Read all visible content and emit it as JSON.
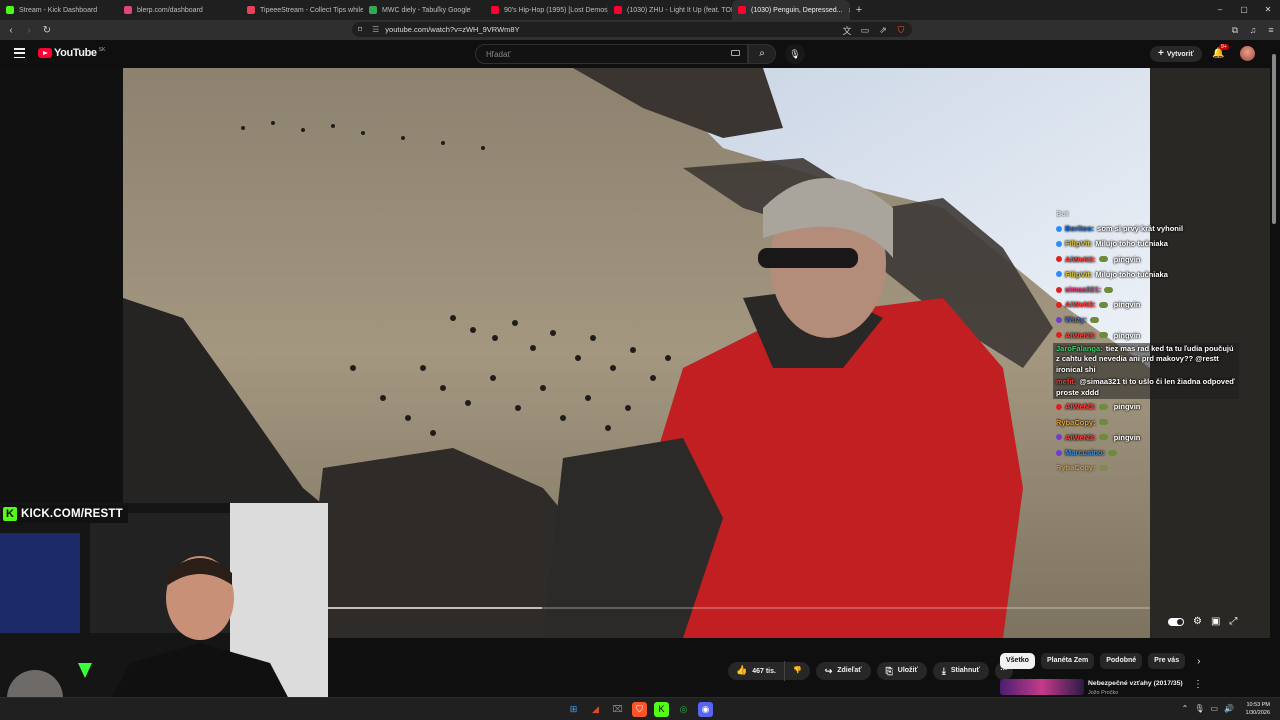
{
  "browser": {
    "tabs": [
      {
        "label": "Stream - Kick Dashboard",
        "color": "#53fc18"
      },
      {
        "label": "blerp.com/dashboard",
        "color": "#e0457b"
      },
      {
        "label": "TipeeeStream - Collect Tips while yo",
        "color": "#e8425b"
      },
      {
        "label": "MWC diely - Tabuľky Google",
        "color": "#34a853"
      },
      {
        "label": "90's Hip-Hop (1995) [Lost Demos] 8",
        "color": "#ff0033"
      },
      {
        "label": "(1030) ZHU - Light It Up (feat. TOKiY",
        "color": "#ff0033"
      },
      {
        "label": "(1030) Penguin, Depressed...",
        "color": "#ff0033",
        "active": true
      }
    ],
    "new_tab": "+",
    "window_controls": [
      "–",
      "▢",
      "✕"
    ],
    "url": "youtube.com/watch?v=zWH_9VRWm8Y"
  },
  "youtube": {
    "logo_text": "YouTube",
    "country_code": "SK",
    "search_placeholder": "Hľadať",
    "create_label": "Vytvoriť",
    "notification_count": "9+"
  },
  "video": {
    "progress_fraction": 0.26
  },
  "chat": [
    {
      "user": "Bot",
      "color": "#cfcfcf",
      "badge": "",
      "msg": "",
      "faded": true
    },
    {
      "user": "Boritoo:",
      "color": "#1e6fd9",
      "badge": "#2a8cff",
      "msg": "som si prvý krát vyhonil"
    },
    {
      "user": "FilipVit:",
      "color": "#d4c23a",
      "badge": "#2a8cff",
      "msg": "Milujo toho tučniaka"
    },
    {
      "user": "AiWeN3:",
      "color": "#ff3b3b",
      "badge": "#e02020",
      "msg": "pingvin",
      "emote": true
    },
    {
      "user": "FilipVit:",
      "color": "#d4c23a",
      "badge": "#2a8cff",
      "msg": "Milujo toho tučniaka"
    },
    {
      "user": "simaa321:",
      "color": "#e03b7a",
      "badge": "#e02020",
      "msg": "",
      "emote": true
    },
    {
      "user": "AiWeN3:",
      "color": "#ff3b3b",
      "badge": "#e02020",
      "msg": "pingvin",
      "emote": true
    },
    {
      "user": "Wuzy:",
      "color": "#4a6fe0",
      "badge": "#6a3fd0",
      "msg": "",
      "emote": true
    },
    {
      "user": "AiWeN3:",
      "color": "#ff3b3b",
      "badge": "#e02020",
      "msg": "pingvin",
      "emote": true
    },
    {
      "user": "JaroFalanga:",
      "color": "#3bd06a",
      "badge": "",
      "msg": "tiez mas rad ked ta tu ľudia poučujú z cahtu ked nevedia ani prd makovy?? @restt ironical shi",
      "multi": true
    },
    {
      "user": "mefit:",
      "color": "#e03b3b",
      "badge": "",
      "msg": "@simaa321 ti to ušlo či len žiadna odpoveď proste xddd",
      "multi": true
    },
    {
      "user": "AiWeN3:",
      "color": "#ff3b3b",
      "badge": "#e02020",
      "msg": "pingvin",
      "emote": true
    },
    {
      "user": "RybaCopy:",
      "color": "#e0a03b",
      "badge": "",
      "msg": "",
      "emote": true
    },
    {
      "user": "AiWeN3:",
      "color": "#ff3b3b",
      "badge": "#6a3fd0",
      "msg": "pingvin",
      "emote": true
    },
    {
      "user": "Marcusino:",
      "color": "#3b8be0",
      "badge": "#6a3fd0",
      "msg": "",
      "emote": true
    },
    {
      "user": "RybaCopy:",
      "color": "#e0a03b",
      "badge": "",
      "msg": "",
      "emote": true,
      "faded": true
    }
  ],
  "overlay": {
    "kick_label": "KICK.COM/RESTT",
    "kick_color": "#53fc18"
  },
  "actions": {
    "likes": "467 tis.",
    "share": "Zdieľať",
    "save": "Uložiť",
    "download": "Stiahnuť",
    "more": "···"
  },
  "chips": [
    "Všetko",
    "Planéta Zem",
    "Podobné",
    "Pre vás"
  ],
  "recommendation": {
    "title": "Nebezpečné vzťahy (2017/35)",
    "channel": "Jožo Pročko"
  },
  "taskbar": {
    "time": "10:53 PM",
    "date": "1/30/2026"
  }
}
